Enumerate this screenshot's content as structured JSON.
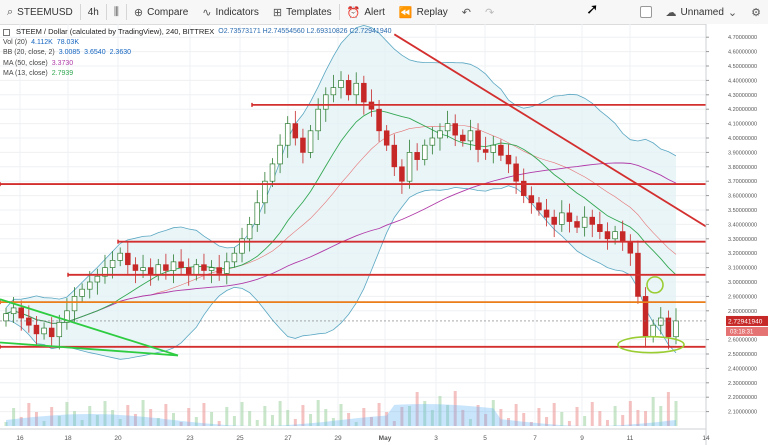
{
  "toolbar": {
    "symbol": "STEEMUSD",
    "interval": "4h",
    "compare": "Compare",
    "indicators": "Indicators",
    "templates": "Templates",
    "alert": "Alert",
    "replay": "Replay",
    "layout_name": "Unnamed"
  },
  "legend": {
    "title": "STEEM / Dollar (calculated by TradingView), 240, BITTREX",
    "ohlc": "O2.73573171  H2.74554560  L2.69310826  C2.72941940",
    "vol": {
      "label": "Vol (20)",
      "v1": "4.112K",
      "v2": "78.03K"
    },
    "bb": {
      "label": "BB (20, close, 2)",
      "v1": "3.0085",
      "v2": "3.6540",
      "v3": "2.3630"
    },
    "ma50": {
      "label": "MA (50, close)",
      "v": "3.3730"
    },
    "ma13": {
      "label": "MA (13, close)",
      "v": "2.7939"
    }
  },
  "chart_data": {
    "type": "candlestick",
    "title": "STEEM / Dollar (calculated by TradingView), 240, BITTREX",
    "ylim": [
      2.0,
      4.75
    ],
    "y_ticks": [
      "4.70000000",
      "4.60000000",
      "4.50000000",
      "4.40000000",
      "4.30000000",
      "4.20000000",
      "4.10000000",
      "4.00000000",
      "3.90000000",
      "3.80000000",
      "3.70000000",
      "3.60000000",
      "3.50000000",
      "3.40000000",
      "3.30000000",
      "3.20000000",
      "3.10000000",
      "3.00000000",
      "2.90000000",
      "2.80000000",
      "2.60000000",
      "2.50000000",
      "2.40000000",
      "2.30000000",
      "2.20000000",
      "2.10000000"
    ],
    "x_ticks": [
      "16",
      "18",
      "20",
      "23",
      "25",
      "27",
      "29",
      "May",
      "3",
      "5",
      "7",
      "9",
      "11",
      "14"
    ],
    "last_price_label": "2.72941940",
    "countdown_label": "03:18:31",
    "close_series": [
      2.78,
      2.82,
      2.75,
      2.7,
      2.64,
      2.68,
      2.62,
      2.72,
      2.8,
      2.9,
      2.95,
      3.0,
      3.04,
      3.1,
      3.15,
      3.2,
      3.12,
      3.08,
      3.1,
      3.05,
      3.12,
      3.08,
      3.14,
      3.1,
      3.05,
      3.12,
      3.08,
      3.1,
      3.06,
      3.14,
      3.2,
      3.3,
      3.4,
      3.55,
      3.7,
      3.82,
      3.95,
      4.1,
      4.0,
      3.9,
      4.05,
      4.2,
      4.3,
      4.35,
      4.4,
      4.3,
      4.38,
      4.25,
      4.2,
      4.05,
      3.95,
      3.8,
      3.7,
      3.9,
      3.85,
      3.95,
      4.0,
      4.05,
      4.1,
      4.02,
      3.98,
      4.05,
      3.92,
      3.9,
      3.95,
      3.88,
      3.82,
      3.7,
      3.6,
      3.55,
      3.5,
      3.45,
      3.4,
      3.48,
      3.42,
      3.38,
      3.45,
      3.4,
      3.35,
      3.3,
      3.35,
      3.28,
      3.2,
      2.9,
      2.62,
      2.7,
      2.75,
      2.62,
      2.73
    ],
    "horizontal_levels": [
      4.23,
      3.68,
      3.28,
      3.05,
      2.86,
      2.55
    ],
    "trendline": {
      "start": {
        "index": 51,
        "value": 4.72
      },
      "end": {
        "index": 118,
        "value": 3.18
      }
    },
    "colors": {
      "up": "#2e7d32",
      "down": "#c62828",
      "level": "#d32f2f",
      "orange_level": "#f39c12",
      "ma50": "#b03aa8",
      "ma13": "#34a853",
      "bb": "#1976d2",
      "highlight": "#9acd32"
    }
  }
}
